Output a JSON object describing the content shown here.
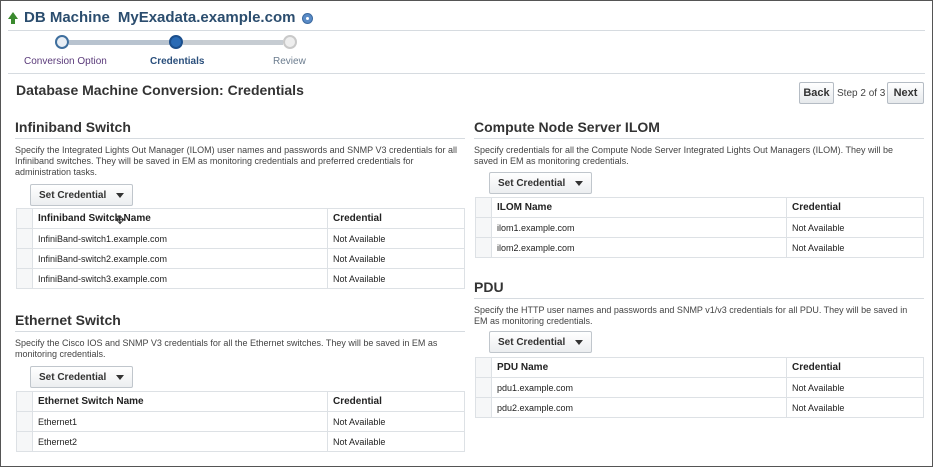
{
  "header": {
    "title": "DB Machine",
    "target": "MyExadata.example.com"
  },
  "train": {
    "steps": [
      "Conversion Option",
      "Credentials",
      "Review"
    ]
  },
  "page": {
    "title": "Database Machine Conversion: Credentials"
  },
  "nav": {
    "back": "Back",
    "step": "Step 2 of 3",
    "next": "Next"
  },
  "infiniband": {
    "title": "Infiniband Switch",
    "description": "Specify the Integrated Lights Out Manager (ILOM) user names and passwords and SNMP V3 credentials for all Infiniband switches. They will be saved in EM as monitoring credentials and preferred credentials for administration tasks.",
    "set_label": "Set Credential",
    "columns": [
      "Infiniband Switch Name",
      "Credential"
    ],
    "rows": [
      [
        "InfiniBand-switch1.example.com",
        "Not Available"
      ],
      [
        "InfiniBand-switch2.example.com",
        "Not Available"
      ],
      [
        "InfiniBand-switch3.example.com",
        "Not Available"
      ]
    ]
  },
  "ethernet": {
    "title": "Ethernet Switch",
    "description": "Specify the Cisco IOS and SNMP V3 credentials for all the Ethernet switches. They will be saved in EM as monitoring credentials.",
    "set_label": "Set Credential",
    "columns": [
      "Ethernet Switch Name",
      "Credential"
    ],
    "rows": [
      [
        "Ethernet1",
        "Not Available"
      ],
      [
        "Ethernet2",
        "Not Available"
      ]
    ]
  },
  "ilom": {
    "title": "Compute Node Server ILOM",
    "description": "Specify credentials for all the Compute Node Server Integrated Lights Out Managers (ILOM). They will be saved in EM as monitoring credentials.",
    "set_label": "Set Credential",
    "columns": [
      "ILOM Name",
      "Credential"
    ],
    "rows": [
      [
        "ilom1.example.com",
        "Not Available"
      ],
      [
        "ilom2.example.com",
        "Not Available"
      ]
    ]
  },
  "pdu": {
    "title": "PDU",
    "description": "Specify the HTTP user names and passwords and SNMP v1/v3 credentials for all PDU. They will be saved in EM as monitoring credentials.",
    "set_label": "Set Credential",
    "columns": [
      "PDU Name",
      "Credential"
    ],
    "rows": [
      [
        "pdu1.example.com",
        "Not Available"
      ],
      [
        "pdu2.example.com",
        "Not Available"
      ]
    ]
  }
}
